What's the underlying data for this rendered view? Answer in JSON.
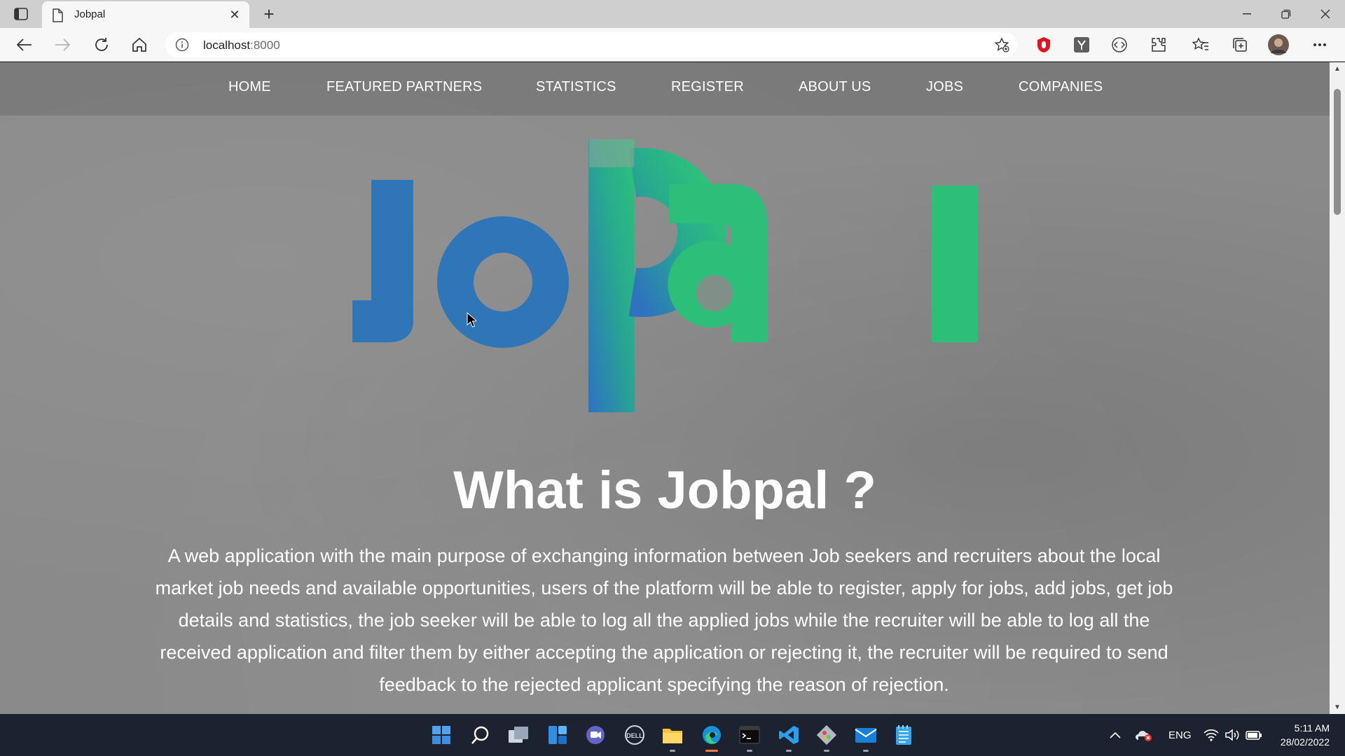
{
  "browser": {
    "tab_title": "Jobpal",
    "new_tab_symbol": "+",
    "close_symbol": "✕",
    "url_host": "localhost",
    "url_port": ":8000"
  },
  "site": {
    "nav": [
      "HOME",
      "FEATURED PARTNERS",
      "STATISTICS",
      "REGISTER",
      "ABOUT US",
      "JOBS",
      "COMPANIES"
    ],
    "logo_text": "Jobpal",
    "headline": "What is Jobpal ?",
    "description": "A web application with the main purpose of exchanging information between Job seekers and recruiters about the local market job needs and available opportunities, users of the platform will be able to register, apply for jobs, add jobs, get job details and statistics, the job seeker will be able to log all the applied jobs while the recruiter will be able to log all the received application and filter them by either accepting the application or rejecting it, the recruiter will be required to send feedback to the rejected applicant specifying the reason of rejection.",
    "colors": {
      "logo_blue": "#2e76b8",
      "logo_green": "#2dbf7a",
      "background": "#8a8a8a"
    }
  },
  "taskbar": {
    "apps": [
      "start-icon",
      "search-icon",
      "task-view-icon",
      "widgets-icon",
      "teams-chat-icon",
      "dell-icon",
      "file-explorer-icon",
      "edge-icon",
      "terminal-icon",
      "vscode-icon",
      "git-icon",
      "mail-icon",
      "notepad-icon"
    ],
    "language": "ENG",
    "time": "5:11 AM",
    "date": "28/02/2022"
  }
}
